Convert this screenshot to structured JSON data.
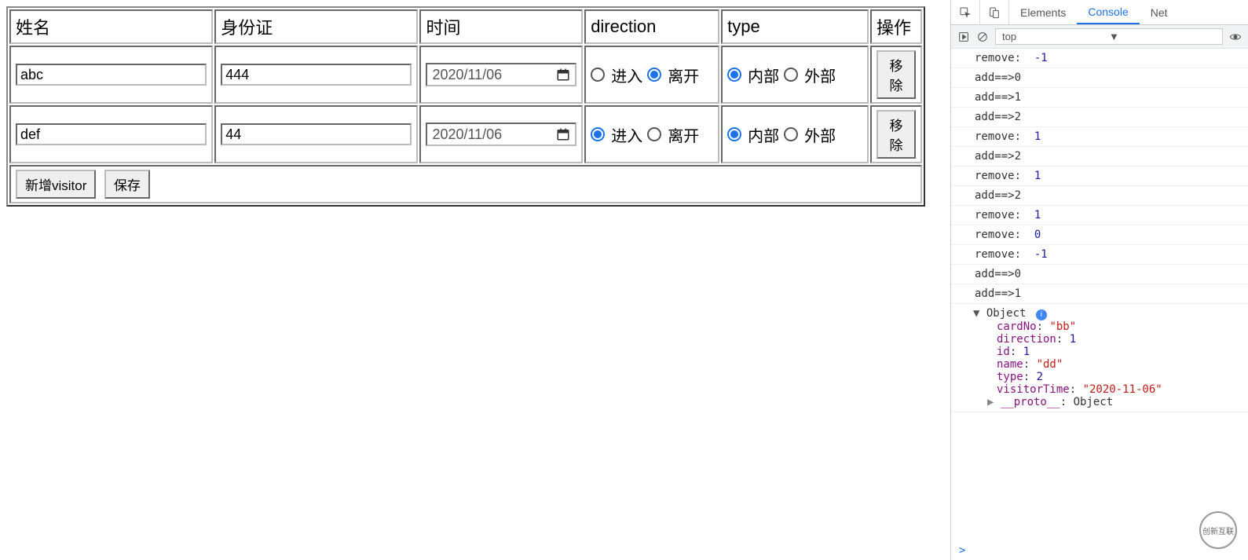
{
  "table": {
    "headers": {
      "name": "姓名",
      "card": "身份证",
      "time": "时间",
      "direction": "direction",
      "type": "type",
      "op": "操作"
    },
    "rows": [
      {
        "name": "abc",
        "card": "444",
        "time_display": "2020/11/06",
        "direction": {
          "enter": "进入",
          "leave": "离开",
          "selected": "leave"
        },
        "type": {
          "internal": "内部",
          "external": "外部",
          "selected": "internal"
        },
        "op_label": "移除"
      },
      {
        "name": "def",
        "card": "44",
        "time_display": "2020/11/06",
        "direction": {
          "enter": "进入",
          "leave": "离开",
          "selected": "enter"
        },
        "type": {
          "internal": "内部",
          "external": "外部",
          "selected": "internal"
        },
        "op_label": "移除"
      }
    ],
    "footer": {
      "add_label": "新增visitor",
      "save_label": "保存"
    }
  },
  "devtools": {
    "tabs": {
      "elements": "Elements",
      "console": "Console",
      "network": "Net"
    },
    "context": "top",
    "logs": [
      {
        "text": "remove:  ",
        "num": "-1"
      },
      {
        "text": "add==>0"
      },
      {
        "text": "add==>1"
      },
      {
        "text": "add==>2"
      },
      {
        "text": "remove:  ",
        "num": "1"
      },
      {
        "text": "add==>2"
      },
      {
        "text": "remove:  ",
        "num": "1"
      },
      {
        "text": "add==>2"
      },
      {
        "text": "remove:  ",
        "num": "1"
      },
      {
        "text": "remove:  ",
        "num": "0"
      },
      {
        "text": "remove:  ",
        "num": "-1"
      },
      {
        "text": "add==>0"
      },
      {
        "text": "add==>1"
      }
    ],
    "object": {
      "label": "Object",
      "props": [
        {
          "k": "cardNo",
          "v": "\"bb\"",
          "t": "str"
        },
        {
          "k": "direction",
          "v": "1",
          "t": "num"
        },
        {
          "k": "id",
          "v": "1",
          "t": "num"
        },
        {
          "k": "name",
          "v": "\"dd\"",
          "t": "str"
        },
        {
          "k": "type",
          "v": "2",
          "t": "num"
        },
        {
          "k": "visitorTime",
          "v": "\"2020-11-06\"",
          "t": "str"
        }
      ],
      "proto": "__proto__",
      "proto_val": "Object"
    },
    "prompt": ">"
  },
  "watermark": "创新互联"
}
